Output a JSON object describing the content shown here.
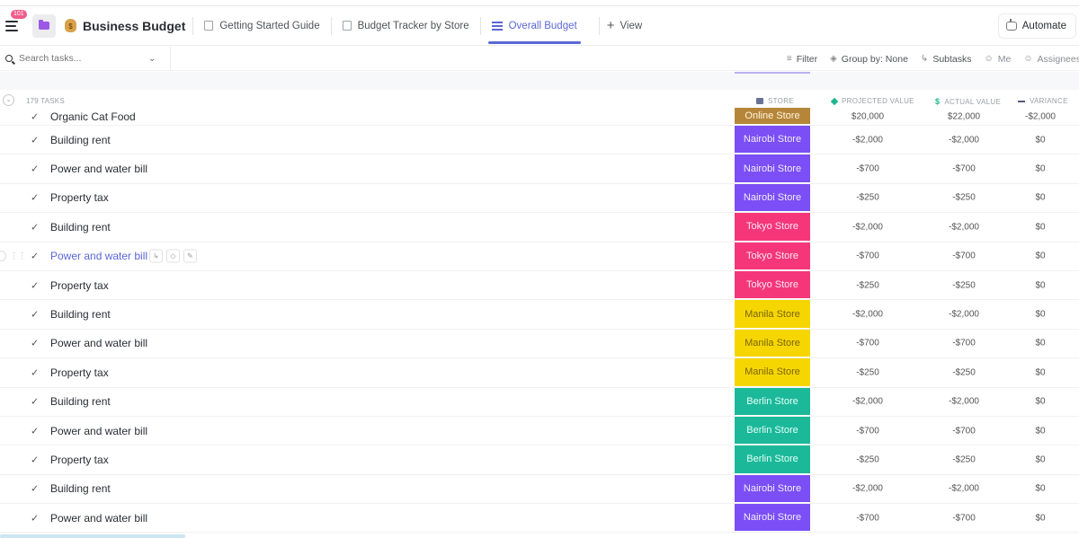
{
  "header": {
    "notification_count": "101",
    "space_title": "Business Budget",
    "tabs": [
      {
        "label": "Getting Started Guide",
        "active": false
      },
      {
        "label": "Budget Tracker by Store",
        "active": false
      },
      {
        "label": "Overall Budget",
        "active": true
      }
    ],
    "add_view_label": "View",
    "automate_label": "Automate"
  },
  "toolbar": {
    "search_placeholder": "Search tasks...",
    "filter_label": "Filter",
    "group_by_label": "Group by: None",
    "subtasks_label": "Subtasks",
    "me_label": "Me",
    "assignees_label": "Assignees"
  },
  "table": {
    "task_count": "179 TASKS",
    "columns": {
      "store": "STORE",
      "projected": "PROJECTED VALUE",
      "actual": "ACTUAL VALUE",
      "variance": "VARIANCE"
    },
    "store_colors": {
      "Online Store": {
        "bg": "#b5863a",
        "fg": "#fff6e0"
      },
      "Nairobi Store": {
        "bg": "#7b4ff5",
        "fg": "#f2ecff"
      },
      "Tokyo Store": {
        "bg": "#f5377a",
        "fg": "#ffe6f0"
      },
      "Manila Store": {
        "bg": "#f6d600",
        "fg": "#7a6400"
      },
      "Berlin Store": {
        "bg": "#1bb99a",
        "fg": "#e5fff8"
      }
    },
    "rows": [
      {
        "name": "Organic Cat Food",
        "store": "Online Store",
        "projected": "$20,000",
        "actual": "$22,000",
        "variance": "-$2,000"
      },
      {
        "name": "Building rent",
        "store": "Nairobi Store",
        "projected": "-$2,000",
        "actual": "-$2,000",
        "variance": "$0"
      },
      {
        "name": "Power and water bill",
        "store": "Nairobi Store",
        "projected": "-$700",
        "actual": "-$700",
        "variance": "$0"
      },
      {
        "name": "Property tax",
        "store": "Nairobi Store",
        "projected": "-$250",
        "actual": "-$250",
        "variance": "$0"
      },
      {
        "name": "Building rent",
        "store": "Tokyo Store",
        "projected": "-$2,000",
        "actual": "-$2,000",
        "variance": "$0"
      },
      {
        "name": "Power and water bill",
        "store": "Tokyo Store",
        "projected": "-$700",
        "actual": "-$700",
        "variance": "$0",
        "hover": true
      },
      {
        "name": "Property tax",
        "store": "Tokyo Store",
        "projected": "-$250",
        "actual": "-$250",
        "variance": "$0"
      },
      {
        "name": "Building rent",
        "store": "Manila Store",
        "projected": "-$2,000",
        "actual": "-$2,000",
        "variance": "$0"
      },
      {
        "name": "Power and water bill",
        "store": "Manila Store",
        "projected": "-$700",
        "actual": "-$700",
        "variance": "$0"
      },
      {
        "name": "Property tax",
        "store": "Manila Store",
        "projected": "-$250",
        "actual": "-$250",
        "variance": "$0"
      },
      {
        "name": "Building rent",
        "store": "Berlin Store",
        "projected": "-$2,000",
        "actual": "-$2,000",
        "variance": "$0"
      },
      {
        "name": "Power and water bill",
        "store": "Berlin Store",
        "projected": "-$700",
        "actual": "-$700",
        "variance": "$0"
      },
      {
        "name": "Property tax",
        "store": "Berlin Store",
        "projected": "-$250",
        "actual": "-$250",
        "variance": "$0"
      },
      {
        "name": "Building rent",
        "store": "Nairobi Store",
        "projected": "-$2,000",
        "actual": "-$2,000",
        "variance": "$0"
      },
      {
        "name": "Power and water bill",
        "store": "Nairobi Store",
        "projected": "-$700",
        "actual": "-$700",
        "variance": "$0"
      }
    ]
  }
}
